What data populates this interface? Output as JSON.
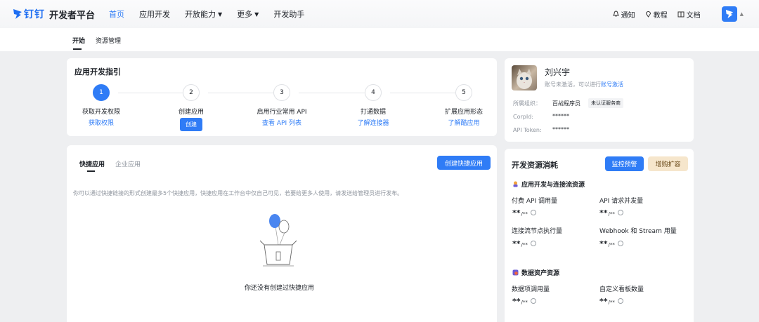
{
  "header": {
    "logo_ding": "钉钉",
    "logo_text": "开发者平台",
    "nav": [
      {
        "label": "首页",
        "active": true
      },
      {
        "label": "应用开发"
      },
      {
        "label": "开放能力",
        "dropdown": true
      },
      {
        "label": "更多",
        "dropdown": true
      },
      {
        "label": "开发助手"
      }
    ],
    "notify": "通知",
    "tutorial": "教程",
    "docs": "文档"
  },
  "subtabs": [
    "开始",
    "资源管理"
  ],
  "guide": {
    "title": "应用开发指引",
    "steps": [
      {
        "num": "1",
        "label": "获取开发权限",
        "link": "获取权限"
      },
      {
        "num": "2",
        "label": "创建应用",
        "button": "创建"
      },
      {
        "num": "3",
        "label": "启用行业常用 API",
        "link": "查看 API 列表"
      },
      {
        "num": "4",
        "label": "打通数据",
        "link": "了解连接器"
      },
      {
        "num": "5",
        "label": "扩展应用形态",
        "link": "了解酷应用"
      }
    ]
  },
  "profile": {
    "name": "刘兴宇",
    "status_prefix": "账号未激活，可以进行",
    "status_link": "账号激活",
    "org_label": "所属组织：",
    "org_value": "百战程序员",
    "org_badge": "未认证服务商",
    "corpid_label": "CorpId:",
    "corpid_value": "******",
    "token_label": "API Token:",
    "token_value": "******"
  },
  "quick": {
    "tabs": [
      "快捷应用",
      "企业应用"
    ],
    "create_button": "创建快捷应用",
    "description": "你可以通过快捷链接的形式创建最多5个快捷应用，快捷应用在工作台中仅自己可见，若要给更多人使用，请发送给管理员进行发布。",
    "empty_text": "你还没有创建过快捷应用"
  },
  "resources": {
    "title": "开发资源消耗",
    "monitor_button": "监控预警",
    "expand_button": "增购扩容",
    "section1": "应用开发与连接流资源",
    "section2": "数据资产资源",
    "masked_value": "**",
    "masked_unit": "/**",
    "metrics1": [
      "付费 API 调用量",
      "API 请求并发量",
      "连接流节点执行量",
      "Webhook 和 Stream 用量"
    ],
    "metrics2": [
      "数据项调用量",
      "自定义看板数量"
    ]
  }
}
